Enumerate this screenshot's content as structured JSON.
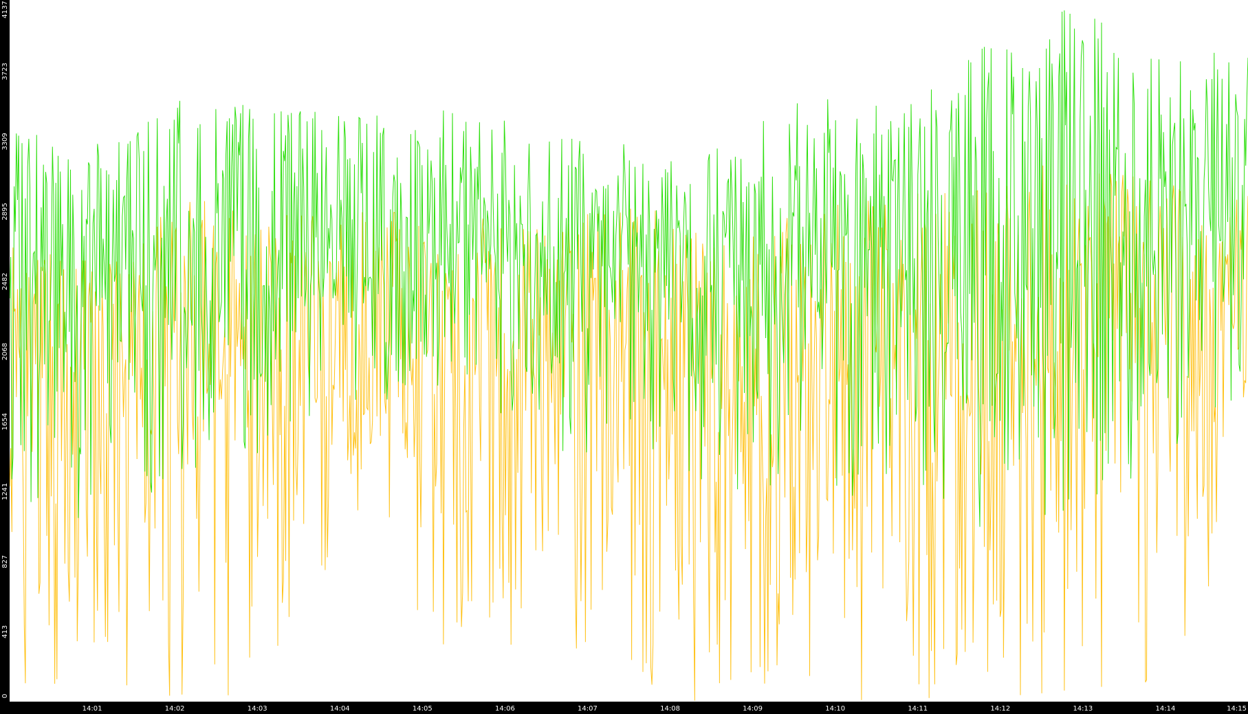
{
  "chart_data": {
    "type": "line",
    "title": "",
    "xlabel": "",
    "ylabel": "",
    "ylim": [
      0,
      4137
    ],
    "yticks": [
      0,
      413,
      827,
      1241,
      1654,
      2068,
      2482,
      2895,
      3309,
      3723,
      4137
    ],
    "xticks": [
      "14:01",
      "14:02",
      "14:03",
      "14:04",
      "14:05",
      "14:06",
      "14:07",
      "14:08",
      "14:09",
      "14:10",
      "14:11",
      "14:12",
      "14:13",
      "14:14",
      "14:15"
    ],
    "x_start": "14:00:00",
    "x_end": "14:15:00",
    "grid": false,
    "legend": "none",
    "background": "#ffffff",
    "axis_bar_color": "#000000",
    "series": [
      {
        "color": "#22dd00",
        "approx_values": [
          2400,
          2700,
          2500,
          2300,
          2450,
          2550,
          2500,
          2650,
          2450,
          2550,
          2600,
          2450,
          2500,
          2600,
          2700,
          2500,
          2550,
          2600,
          2800,
          2700,
          2900
        ],
        "approx_min": [
          1200,
          1000,
          1300,
          1500,
          1800,
          1600,
          1400,
          1500,
          1200,
          1300,
          900,
          1000,
          1100,
          1400,
          1800
        ],
        "approx_max": [
          3400,
          3300,
          3600,
          3500,
          3500,
          3500,
          3400,
          3300,
          3300,
          3600,
          3500,
          3900,
          4137,
          3900,
          3900
        ]
      },
      {
        "color": "#ffbb00",
        "approx_values": [
          1900,
          1700,
          1900,
          1800,
          2100,
          2200,
          2000,
          2100,
          1900,
          2000,
          2100,
          1900,
          1800,
          2000,
          2100,
          1800,
          1900,
          2100,
          2200,
          2100,
          2300
        ],
        "approx_min": [
          0,
          0,
          0,
          0,
          1200,
          0,
          500,
          0,
          0,
          0,
          0,
          0,
          0,
          0,
          1200
        ],
        "approx_max": [
          2700,
          2600,
          3000,
          2900,
          2900,
          2900,
          2800,
          3000,
          2700,
          2900,
          3000,
          3100,
          3200,
          3100,
          3000
        ]
      }
    ]
  }
}
